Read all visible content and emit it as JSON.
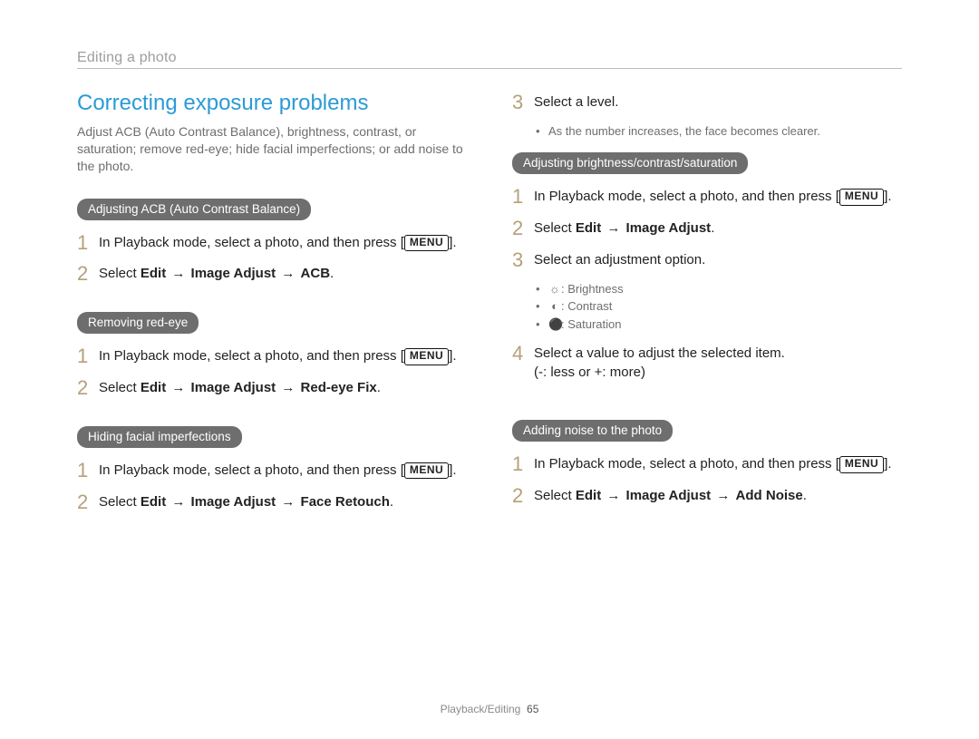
{
  "breadcrumb": "Editing a photo",
  "title": "Correcting exposure problems",
  "intro": "Adjust ACB (Auto Contrast Balance), brightness, contrast, or saturation; remove red-eye; hide facial imperfections; or add noise to the photo.",
  "menu_label": "MENU",
  "arrow": "→",
  "sections": {
    "acb": {
      "pill": "Adjusting ACB (Auto Contrast Balance)",
      "step1_a": "In Playback mode, select a photo, and then press ",
      "step1_b": ".",
      "step2_a": "Select ",
      "step2_b": "Edit",
      "step2_c": "Image Adjust",
      "step2_d": "ACB",
      "step2_e": "."
    },
    "redeye": {
      "pill": "Removing red-eye",
      "step1_a": "In Playback mode, select a photo, and then press ",
      "step1_b": ".",
      "step2_a": "Select ",
      "step2_b": "Edit",
      "step2_c": "Image Adjust",
      "step2_d": "Red-eye Fix",
      "step2_e": "."
    },
    "face": {
      "pill": "Hiding facial imperfections",
      "step1_a": "In Playback mode, select a photo, and then press ",
      "step1_b": ".",
      "step2_a": "Select ",
      "step2_b": "Edit",
      "step2_c": "Image Adjust",
      "step2_d": "Face Retouch",
      "step2_e": ".",
      "step3": "Select a level.",
      "step3_note": "As the number increases, the face becomes clearer."
    },
    "bcs": {
      "pill": "Adjusting brightness/contrast/saturation",
      "step1_a": "In Playback mode, select a photo, and then press ",
      "step1_b": ".",
      "step2_a": "Select ",
      "step2_b": "Edit",
      "step2_c": "Image Adjust",
      "step2_d": ".",
      "step3": "Select an adjustment option.",
      "opt_brightness": ": Brightness",
      "opt_contrast": ": Contrast",
      "opt_saturation": ": Saturation",
      "step4_a": "Select a value to adjust the selected item.",
      "step4_b": "(-: less or +: more)"
    },
    "noise": {
      "pill": "Adding noise to the photo",
      "step1_a": "In Playback mode, select a photo, and then press ",
      "step1_b": ".",
      "step2_a": "Select ",
      "step2_b": "Edit",
      "step2_c": "Image Adjust",
      "step2_d": "Add Noise",
      "step2_e": "."
    }
  },
  "nums": {
    "n1": "1",
    "n2": "2",
    "n3": "3",
    "n4": "4"
  },
  "icons": {
    "brightness": "☼",
    "contrast": "◐",
    "saturation": "⚫"
  },
  "footer": {
    "section": "Playback/Editing",
    "page": "65"
  }
}
